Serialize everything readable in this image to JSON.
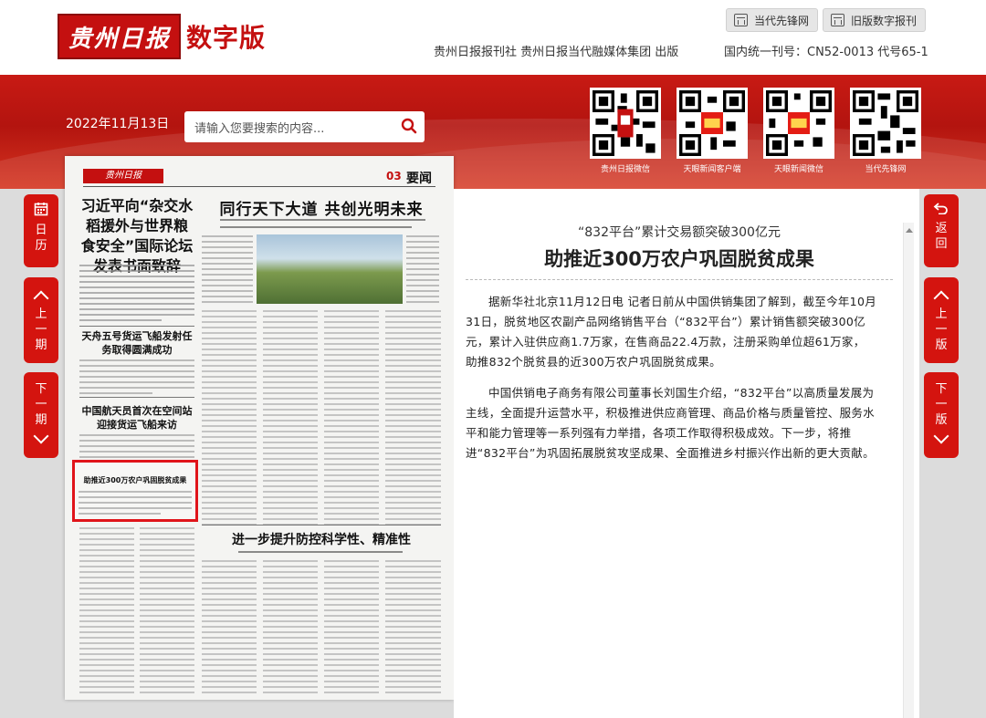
{
  "header": {
    "logo_text": "贵州日报",
    "logo_digital": "数字版",
    "publisher": "贵州日报报刊社 贵州日报当代融媒体集团 出版",
    "issn": "国内统一刊号：CN52-0013 代号65-1",
    "buttons": [
      {
        "label": "当代先锋网"
      },
      {
        "label": "旧版数字报刊"
      }
    ]
  },
  "toolbar": {
    "date": "2022年11月13日",
    "search_placeholder": "请输入您要搜索的内容..."
  },
  "qr_codes": [
    {
      "label": "贵州日报微信"
    },
    {
      "label": "天眼新闻客户端"
    },
    {
      "label": "天眼新闻微信"
    },
    {
      "label": "当代先锋网"
    }
  ],
  "left_nav": {
    "calendar": "日历",
    "prev_issue": "上一期",
    "next_issue": "下一期"
  },
  "right_nav": {
    "back": "返回",
    "prev_page": "上一版",
    "next_page": "下一版"
  },
  "newspaper": {
    "masthead": "贵州日报",
    "page_no": "03",
    "page_name": "要闻",
    "headlines": [
      "习近平向“杂交水稻援外与世界粮食安全”国际论坛发表书面致辞",
      "同行天下大道 共创光明未来",
      "天舟五号货运飞船发射任务取得圆满成功",
      "中国航天员首次在空间站迎接货运飞船来访",
      "助推近300万农户巩固脱贫成果",
      "进一步提升防控科学性、精准性"
    ]
  },
  "article": {
    "subtitle": "“832平台”累计交易额突破300亿元",
    "title": "助推近300万农户巩固脱贫成果",
    "paragraphs": [
      "据新华社北京11月12日电 记者日前从中国供销集团了解到，截至今年10月31日，脱贫地区农副产品网络销售平台（“832平台”）累计销售额突破300亿元，累计入驻供应商1.7万家，在售商品22.4万款，注册采购单位超61万家，助推832个脱贫县的近300万农户巩固脱贫成果。",
      "中国供销电子商务有限公司董事长刘国生介绍，“832平台”以高质量发展为主线，全面提升运营水平，积极推进供应商管理、商品价格与质量管控、服务水平和能力管理等一系列强有力举措，各项工作取得积极成效。下一步，将推进“832平台”为巩固拓展脱贫攻坚成果、全面推进乡村振兴作出新的更大贡献。"
    ]
  },
  "colors": {
    "brand_red": "#c41010",
    "nav_red": "#d4140f"
  }
}
